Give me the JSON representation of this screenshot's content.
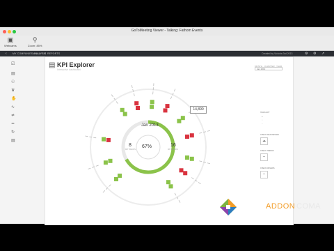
{
  "window": {
    "title": "GoToMeeting Viewer - Talking: Fathom Events"
  },
  "toolbar": {
    "buttons": [
      {
        "label": "Webcams",
        "icon": "camera-icon"
      },
      {
        "label": "Zoom: 85%",
        "icon": "zoom-icon"
      }
    ]
  },
  "appnav": {
    "items": [
      "MY COMPANIES",
      "ANALYSIS",
      "REPORTS"
    ],
    "right_text": "Created by Victoria 3rd 2013"
  },
  "kpi": {
    "title": "KPI Explorer",
    "subtitle": "Interactive dashboard",
    "period": "Jan 2013",
    "center_percent": "67%",
    "left_count": "8",
    "left_label": "KPI TRACKS",
    "right_count": "16",
    "right_label": "KPI TRACKS",
    "tooltip_value": "14,890",
    "top_controls": [
      "MONTH",
      "QUARTER",
      "YEAR"
    ],
    "select_value": "Jan 2013"
  },
  "right_panel": {
    "labels": [
      "HIGHLIGHT",
      "CHECK WEAKNESSES",
      "CHECK TRENDS",
      "CHECK DRIVERS"
    ]
  },
  "brand": {
    "part1": "ADDON",
    "part2": "COMA"
  },
  "colors": {
    "red": "#d9333f",
    "green": "#8bc34a",
    "accent": "#f39c26"
  }
}
